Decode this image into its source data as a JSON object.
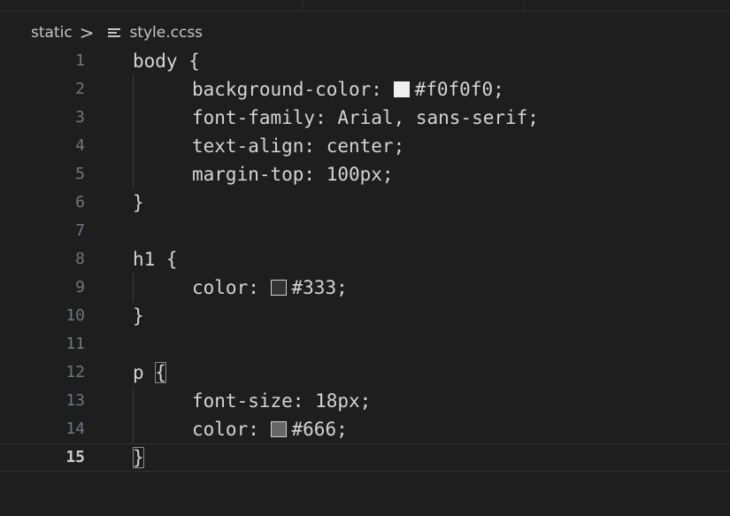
{
  "breadcrumb": {
    "folder": "static",
    "separator": ">",
    "file_icon": "lines-file-icon",
    "file": "style.ccss"
  },
  "editor": {
    "current_line": 15,
    "lines": [
      {
        "num": "1",
        "text": "body {"
      },
      {
        "num": "2",
        "prop": "background-color:",
        "swatch": "#f0f0f0",
        "value": "#f0f0f0;"
      },
      {
        "num": "3",
        "text": "font-family: Arial, sans-serif;"
      },
      {
        "num": "4",
        "text": "text-align: center;"
      },
      {
        "num": "5",
        "text": "margin-top: 100px;"
      },
      {
        "num": "6",
        "text": "}"
      },
      {
        "num": "7",
        "text": ""
      },
      {
        "num": "8",
        "text": "h1 {"
      },
      {
        "num": "9",
        "prop": "color:",
        "swatch": "#333333",
        "value": "#333;"
      },
      {
        "num": "10",
        "text": "}"
      },
      {
        "num": "11",
        "text": ""
      },
      {
        "num": "12",
        "text": "p {"
      },
      {
        "num": "13",
        "text": "font-size: 18px;"
      },
      {
        "num": "14",
        "prop": "color:",
        "swatch": "#666666",
        "value": "#666;"
      },
      {
        "num": "15",
        "text": "}"
      }
    ]
  },
  "colors": {
    "background": "#1e1e1e",
    "text": "#d4d4d4",
    "line_number": "#6e7681",
    "current_line_number": "#cccccc"
  }
}
